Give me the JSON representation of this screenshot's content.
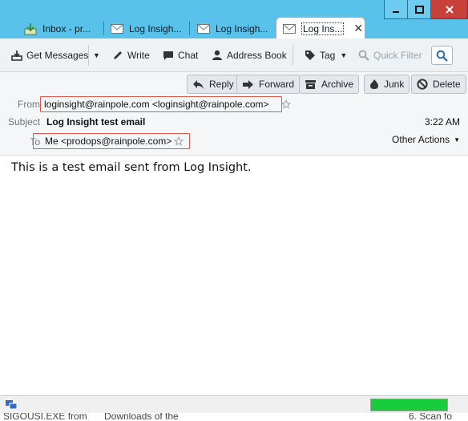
{
  "window": {
    "tabs": [
      {
        "label": "Inbox - pr...",
        "icon": "inbox-download-icon"
      },
      {
        "label": "Log Insigh...",
        "icon": "envelope-icon"
      },
      {
        "label": "Log Insigh...",
        "icon": "envelope-icon"
      },
      {
        "label": "Log Ins...",
        "icon": "envelope-icon",
        "active": true
      }
    ]
  },
  "toolbar": {
    "get_messages": "Get Messages",
    "write": "Write",
    "chat": "Chat",
    "address_book": "Address Book",
    "tag": "Tag",
    "quick_filter": "Quick Filter"
  },
  "actions": {
    "reply": "Reply",
    "forward": "Forward",
    "archive": "Archive",
    "junk": "Junk",
    "delete": "Delete"
  },
  "header": {
    "from_label": "From",
    "from_value": "loginsight@rainpole.com <loginsight@rainpole.com>",
    "subject_label": "Subject",
    "subject_value": "Log Insight test email",
    "time": "3:22 AM",
    "to_label": "To",
    "to_value": "Me <prodops@rainpole.com>",
    "other_actions": "Other Actions"
  },
  "body": {
    "text": "This is a test email sent from Log Insight."
  },
  "status": {
    "progress": 1.0,
    "progress_color": "#19cc3c"
  },
  "desktop": {
    "left_text": "SIGOUSI.EXE from",
    "middle_text": "Downloads of the",
    "right_text": "6. Scan fo"
  },
  "colors": {
    "titlebar": "#58c2ea",
    "highlight_border": "#e2574c"
  }
}
